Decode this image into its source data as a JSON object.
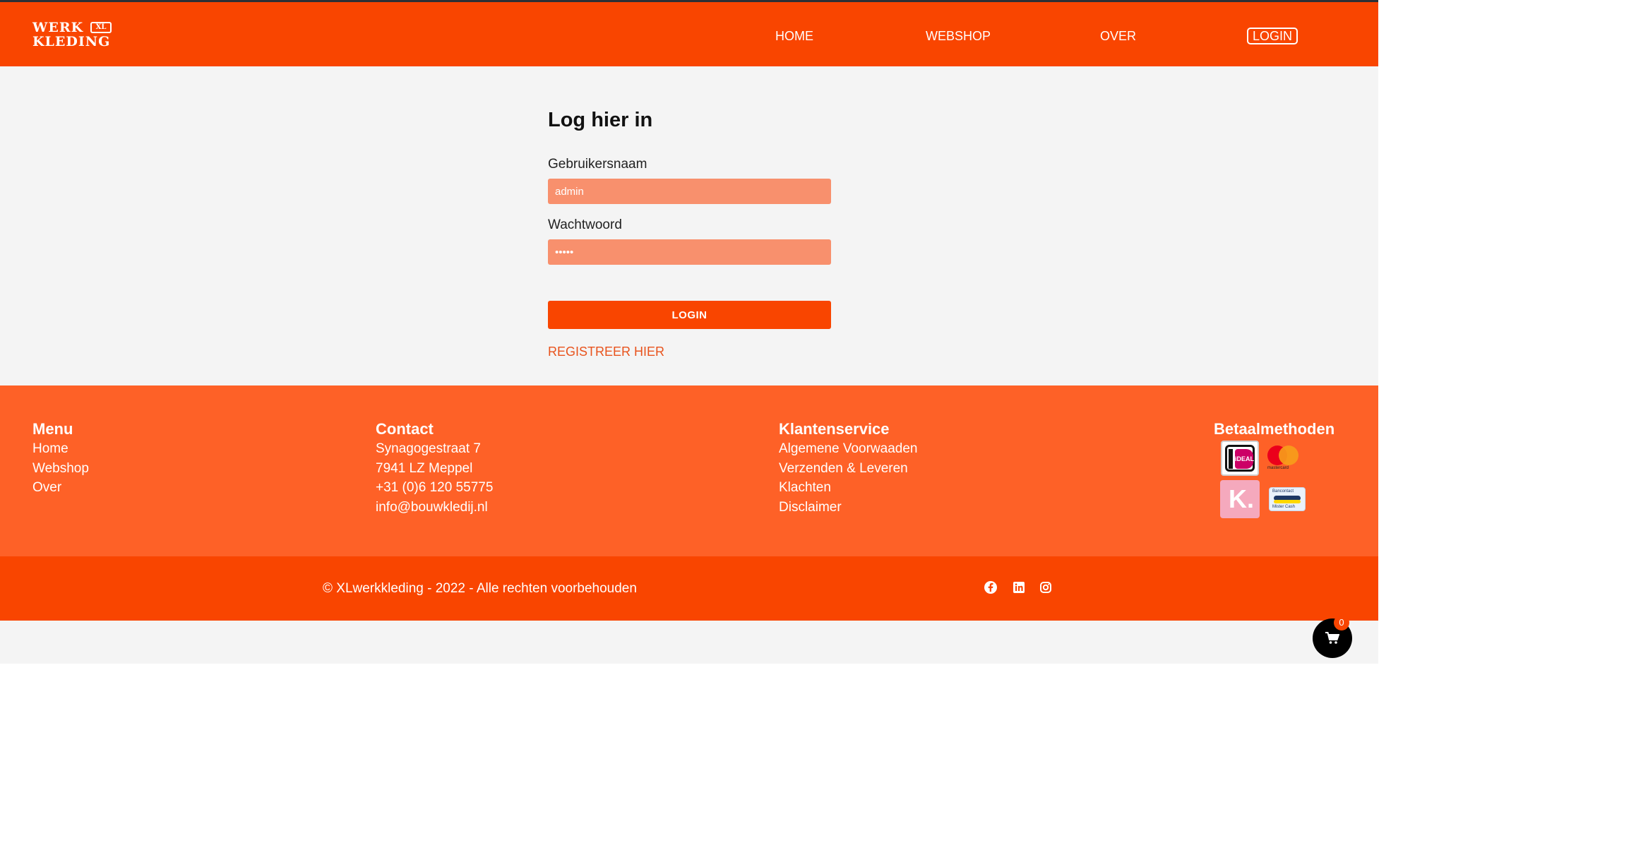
{
  "header": {
    "logo": {
      "line1": "WERK",
      "line2": "KLEDING",
      "badge": "XL"
    },
    "nav": [
      {
        "label": "HOME"
      },
      {
        "label": "WEBSHOP"
      },
      {
        "label": "OVER"
      },
      {
        "label": "LOGIN",
        "active": true
      }
    ]
  },
  "login": {
    "title": "Log hier in",
    "username_label": "Gebruikersnaam",
    "username_value": "admin",
    "password_label": "Wachtwoord",
    "password_value": "•••••",
    "submit_label": "LOGIN",
    "register_link": "REGISTREER HIER"
  },
  "footer": {
    "menu": {
      "heading": "Menu",
      "items": [
        "Home",
        "Webshop",
        "Over"
      ]
    },
    "contact": {
      "heading": "Contact",
      "items": [
        "Synagogestraat 7",
        "7941 LZ Meppel",
        "+31 (0)6 120 55775",
        "info@bouwkledij.nl"
      ]
    },
    "klantenservice": {
      "heading": "Klantenservice",
      "items": [
        "Algemene Voorwaaden",
        "Verzenden & Leveren",
        "Klachten",
        "Disclaimer"
      ]
    },
    "betaalmethoden": {
      "heading": "Betaalmethoden",
      "ideal_text": "iDEAL",
      "mastercard_text": "mastercard",
      "klarna_text": "K.",
      "bancontact_text_top": "Bancontact",
      "bancontact_text_bottom": "Mister Cash"
    },
    "copyright": "© XLwerkkleding - 2022 - Alle rechten voorbehouden"
  },
  "cart": {
    "count": "0"
  },
  "colors": {
    "brand": "#f94500",
    "footer": "#fe6127",
    "input": "#f8906d",
    "background": "#f4f4f4"
  },
  "icons": [
    "facebook-icon",
    "linkedin-icon",
    "instagram-icon",
    "cart-icon"
  ]
}
